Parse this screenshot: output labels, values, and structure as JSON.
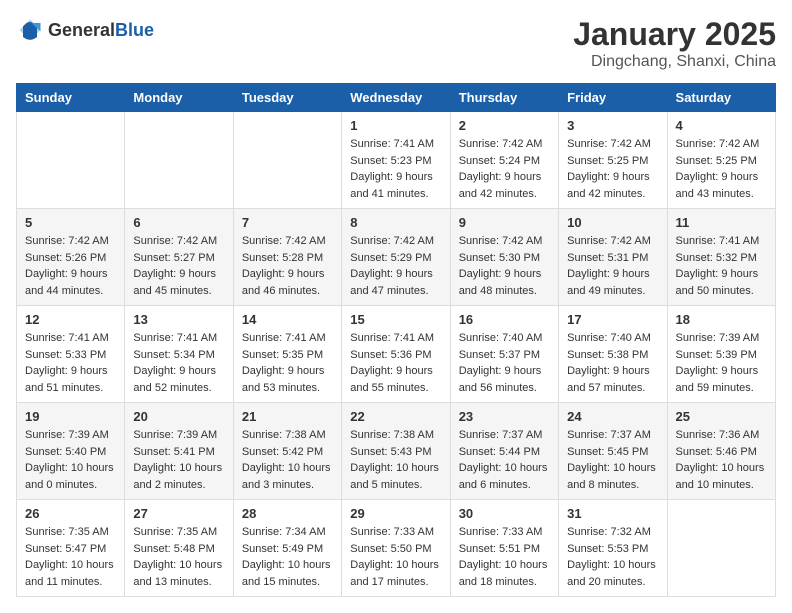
{
  "header": {
    "logo": {
      "general": "General",
      "blue": "Blue"
    },
    "title": "January 2025",
    "subtitle": "Dingchang, Shanxi, China"
  },
  "weekdays": [
    "Sunday",
    "Monday",
    "Tuesday",
    "Wednesday",
    "Thursday",
    "Friday",
    "Saturday"
  ],
  "weeks": [
    [
      {
        "day": "",
        "sunrise": "",
        "sunset": "",
        "daylight": ""
      },
      {
        "day": "",
        "sunrise": "",
        "sunset": "",
        "daylight": ""
      },
      {
        "day": "",
        "sunrise": "",
        "sunset": "",
        "daylight": ""
      },
      {
        "day": "1",
        "sunrise": "Sunrise: 7:41 AM",
        "sunset": "Sunset: 5:23 PM",
        "daylight": "Daylight: 9 hours and 41 minutes."
      },
      {
        "day": "2",
        "sunrise": "Sunrise: 7:42 AM",
        "sunset": "Sunset: 5:24 PM",
        "daylight": "Daylight: 9 hours and 42 minutes."
      },
      {
        "day": "3",
        "sunrise": "Sunrise: 7:42 AM",
        "sunset": "Sunset: 5:25 PM",
        "daylight": "Daylight: 9 hours and 42 minutes."
      },
      {
        "day": "4",
        "sunrise": "Sunrise: 7:42 AM",
        "sunset": "Sunset: 5:25 PM",
        "daylight": "Daylight: 9 hours and 43 minutes."
      }
    ],
    [
      {
        "day": "5",
        "sunrise": "Sunrise: 7:42 AM",
        "sunset": "Sunset: 5:26 PM",
        "daylight": "Daylight: 9 hours and 44 minutes."
      },
      {
        "day": "6",
        "sunrise": "Sunrise: 7:42 AM",
        "sunset": "Sunset: 5:27 PM",
        "daylight": "Daylight: 9 hours and 45 minutes."
      },
      {
        "day": "7",
        "sunrise": "Sunrise: 7:42 AM",
        "sunset": "Sunset: 5:28 PM",
        "daylight": "Daylight: 9 hours and 46 minutes."
      },
      {
        "day": "8",
        "sunrise": "Sunrise: 7:42 AM",
        "sunset": "Sunset: 5:29 PM",
        "daylight": "Daylight: 9 hours and 47 minutes."
      },
      {
        "day": "9",
        "sunrise": "Sunrise: 7:42 AM",
        "sunset": "Sunset: 5:30 PM",
        "daylight": "Daylight: 9 hours and 48 minutes."
      },
      {
        "day": "10",
        "sunrise": "Sunrise: 7:42 AM",
        "sunset": "Sunset: 5:31 PM",
        "daylight": "Daylight: 9 hours and 49 minutes."
      },
      {
        "day": "11",
        "sunrise": "Sunrise: 7:41 AM",
        "sunset": "Sunset: 5:32 PM",
        "daylight": "Daylight: 9 hours and 50 minutes."
      }
    ],
    [
      {
        "day": "12",
        "sunrise": "Sunrise: 7:41 AM",
        "sunset": "Sunset: 5:33 PM",
        "daylight": "Daylight: 9 hours and 51 minutes."
      },
      {
        "day": "13",
        "sunrise": "Sunrise: 7:41 AM",
        "sunset": "Sunset: 5:34 PM",
        "daylight": "Daylight: 9 hours and 52 minutes."
      },
      {
        "day": "14",
        "sunrise": "Sunrise: 7:41 AM",
        "sunset": "Sunset: 5:35 PM",
        "daylight": "Daylight: 9 hours and 53 minutes."
      },
      {
        "day": "15",
        "sunrise": "Sunrise: 7:41 AM",
        "sunset": "Sunset: 5:36 PM",
        "daylight": "Daylight: 9 hours and 55 minutes."
      },
      {
        "day": "16",
        "sunrise": "Sunrise: 7:40 AM",
        "sunset": "Sunset: 5:37 PM",
        "daylight": "Daylight: 9 hours and 56 minutes."
      },
      {
        "day": "17",
        "sunrise": "Sunrise: 7:40 AM",
        "sunset": "Sunset: 5:38 PM",
        "daylight": "Daylight: 9 hours and 57 minutes."
      },
      {
        "day": "18",
        "sunrise": "Sunrise: 7:39 AM",
        "sunset": "Sunset: 5:39 PM",
        "daylight": "Daylight: 9 hours and 59 minutes."
      }
    ],
    [
      {
        "day": "19",
        "sunrise": "Sunrise: 7:39 AM",
        "sunset": "Sunset: 5:40 PM",
        "daylight": "Daylight: 10 hours and 0 minutes."
      },
      {
        "day": "20",
        "sunrise": "Sunrise: 7:39 AM",
        "sunset": "Sunset: 5:41 PM",
        "daylight": "Daylight: 10 hours and 2 minutes."
      },
      {
        "day": "21",
        "sunrise": "Sunrise: 7:38 AM",
        "sunset": "Sunset: 5:42 PM",
        "daylight": "Daylight: 10 hours and 3 minutes."
      },
      {
        "day": "22",
        "sunrise": "Sunrise: 7:38 AM",
        "sunset": "Sunset: 5:43 PM",
        "daylight": "Daylight: 10 hours and 5 minutes."
      },
      {
        "day": "23",
        "sunrise": "Sunrise: 7:37 AM",
        "sunset": "Sunset: 5:44 PM",
        "daylight": "Daylight: 10 hours and 6 minutes."
      },
      {
        "day": "24",
        "sunrise": "Sunrise: 7:37 AM",
        "sunset": "Sunset: 5:45 PM",
        "daylight": "Daylight: 10 hours and 8 minutes."
      },
      {
        "day": "25",
        "sunrise": "Sunrise: 7:36 AM",
        "sunset": "Sunset: 5:46 PM",
        "daylight": "Daylight: 10 hours and 10 minutes."
      }
    ],
    [
      {
        "day": "26",
        "sunrise": "Sunrise: 7:35 AM",
        "sunset": "Sunset: 5:47 PM",
        "daylight": "Daylight: 10 hours and 11 minutes."
      },
      {
        "day": "27",
        "sunrise": "Sunrise: 7:35 AM",
        "sunset": "Sunset: 5:48 PM",
        "daylight": "Daylight: 10 hours and 13 minutes."
      },
      {
        "day": "28",
        "sunrise": "Sunrise: 7:34 AM",
        "sunset": "Sunset: 5:49 PM",
        "daylight": "Daylight: 10 hours and 15 minutes."
      },
      {
        "day": "29",
        "sunrise": "Sunrise: 7:33 AM",
        "sunset": "Sunset: 5:50 PM",
        "daylight": "Daylight: 10 hours and 17 minutes."
      },
      {
        "day": "30",
        "sunrise": "Sunrise: 7:33 AM",
        "sunset": "Sunset: 5:51 PM",
        "daylight": "Daylight: 10 hours and 18 minutes."
      },
      {
        "day": "31",
        "sunrise": "Sunrise: 7:32 AM",
        "sunset": "Sunset: 5:53 PM",
        "daylight": "Daylight: 10 hours and 20 minutes."
      },
      {
        "day": "",
        "sunrise": "",
        "sunset": "",
        "daylight": ""
      }
    ]
  ]
}
